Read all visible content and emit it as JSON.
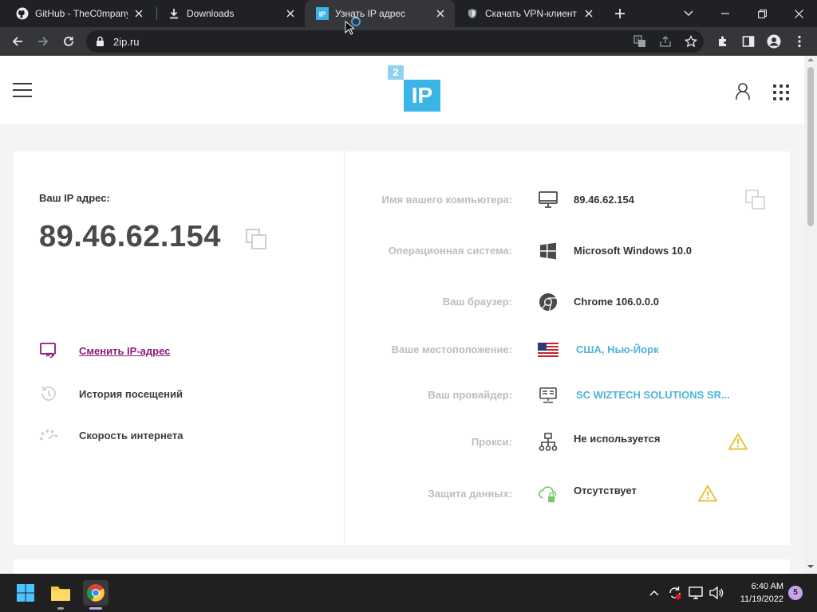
{
  "browser": {
    "tabs": [
      {
        "title": "GitHub - TheC0mpany/",
        "icon": "github-icon"
      },
      {
        "title": "Downloads",
        "icon": "download-icon"
      },
      {
        "title": "Узнать IP адрес",
        "icon": "2ip-favicon",
        "active": true
      },
      {
        "title": "Скачать VPN-клиент д",
        "icon": "shield-favicon"
      }
    ],
    "url": "2ip.ru"
  },
  "site": {
    "logo_small": "2",
    "logo_main": "IP",
    "ip_label": "Ваш IP адрес:",
    "ip_value": "89.46.62.154",
    "left_links": [
      {
        "label": "Сменить IP-адрес",
        "icon": "change-ip-icon"
      },
      {
        "label": "История посещений",
        "icon": "history-icon"
      },
      {
        "label": "Скорость интернета",
        "icon": "speed-icon"
      }
    ],
    "details": [
      {
        "label": "Имя вашего компьютера:",
        "value": "89.46.62.154",
        "icon": "monitor-icon"
      },
      {
        "label": "Операционная система:",
        "value": "Microsoft Windows 10.0",
        "icon": "windows-icon"
      },
      {
        "label": "Ваш браузер:",
        "value": "Chrome 106.0.0.0",
        "icon": "chrome-icon"
      },
      {
        "label": "Ваше местоположение:",
        "value": "США, Нью-Йорк",
        "icon": "us-flag-icon"
      },
      {
        "label": "Ваш провайдер:",
        "value": "SC WIZTECH SOLUTIONS SR...",
        "icon": "provider-icon"
      },
      {
        "label": "Прокси:",
        "value": "Не используется",
        "icon": "proxy-icon"
      },
      {
        "label": "Защита данных:",
        "value": "Отсутствует",
        "icon": "cloud-lock-icon"
      }
    ]
  },
  "taskbar": {
    "time": "6:40 AM",
    "date": "11/19/2022",
    "notifications": "5"
  },
  "colors": {
    "accent": "#3bb5e8",
    "link_purple": "#8a1b7c",
    "link_blue": "#4fb3d9",
    "warning": "#e8c33a"
  }
}
